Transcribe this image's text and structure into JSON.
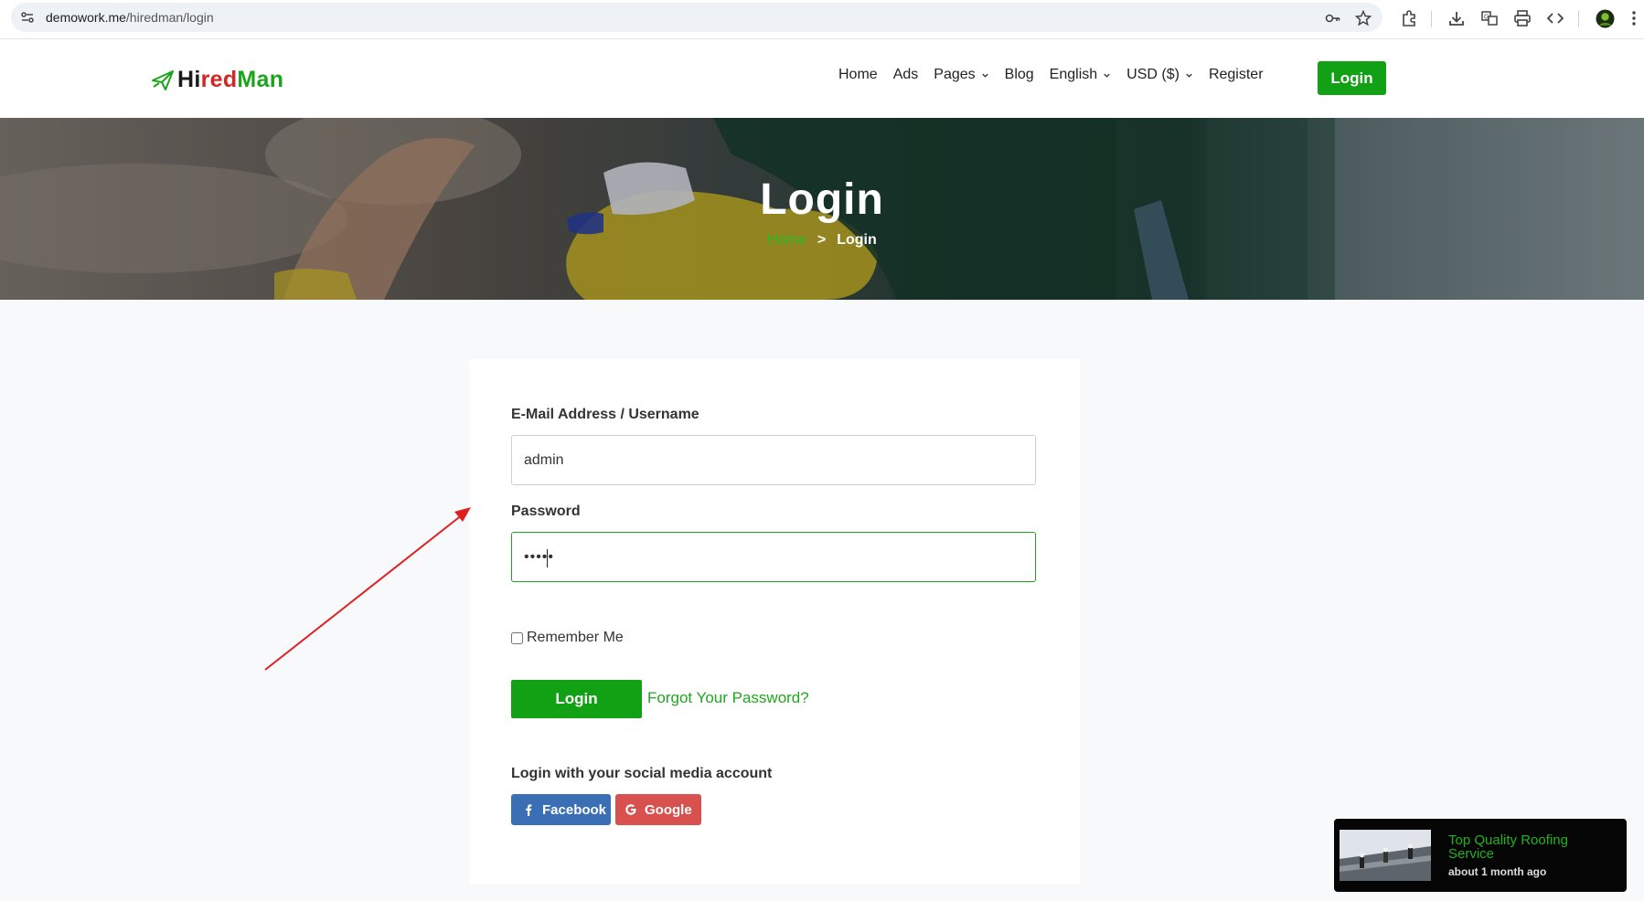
{
  "browser": {
    "url_host": "demowork.me",
    "url_path": "/hiredman/login",
    "icons": [
      "site-info-icon",
      "password-key-icon",
      "bookmark-star-icon",
      "extensions-icon",
      "download-icon",
      "translate-icon",
      "print-icon",
      "code-icon",
      "profile-avatar-icon",
      "more-menu-icon"
    ]
  },
  "header": {
    "logo": {
      "part1": "Hi",
      "part2": "red",
      "part3": "Man"
    },
    "nav": {
      "home": "Home",
      "ads": "Ads",
      "pages": "Pages",
      "blog": "Blog",
      "language": "English",
      "currency": "USD ($)",
      "register": "Register",
      "login": "Login"
    }
  },
  "hero": {
    "title": "Login",
    "breadcrumb_home": "Home",
    "breadcrumb_sep": ">",
    "breadcrumb_current": "Login"
  },
  "form": {
    "email_label": "E-Mail Address / Username",
    "email_value": "admin",
    "password_label": "Password",
    "password_value": "•••••",
    "remember_label": "Remember Me",
    "remember_checked": false,
    "login_button": "Login",
    "forgot_link": "Forgot Your Password?",
    "social_title": "Login with your social media account",
    "facebook_button": "Facebook",
    "google_button": "Google"
  },
  "toast": {
    "title": "Top Quality Roofing Service",
    "time": "about 1 month ago"
  },
  "colors": {
    "brand_green": "#12a014",
    "link_green": "#1fa81f",
    "logo_red": "#d42626",
    "facebook_blue": "#3b6fb5",
    "google_red": "#d9514f",
    "annotation_arrow": "#e02020"
  }
}
